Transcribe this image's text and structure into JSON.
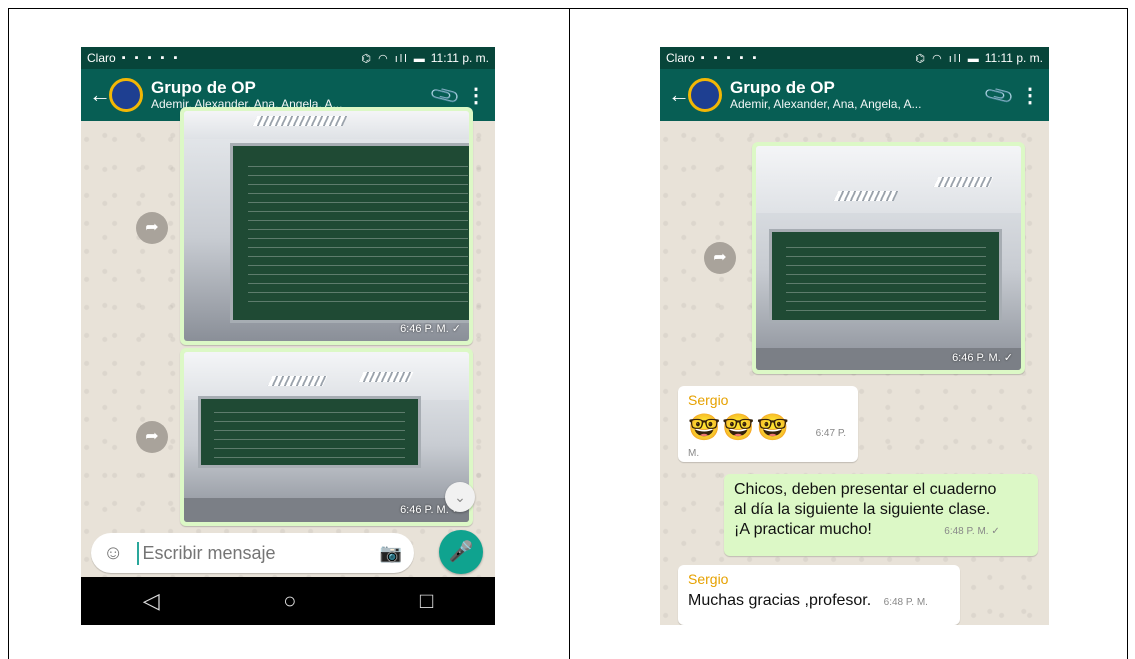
{
  "status": {
    "carrier": "Claro",
    "time": "11:11 p. m.",
    "left_icons": "▪ ▪ ▪ ▪ ▪",
    "right_icons": "⌬ ◠ ıll ▬"
  },
  "chat": {
    "group_title": "Grupo de OP",
    "subtitle": "Ademir, Alexander, Ana, Angela, A..."
  },
  "icons": {
    "back": "←",
    "attach": "📎",
    "more": "⋮",
    "forward": "➦",
    "emoji": "☺",
    "camera": "📷",
    "mic": "🎤",
    "nav_back": "◁",
    "nav_home": "○",
    "nav_recent": "□",
    "scroll_down": "⌄"
  },
  "left_screen": {
    "messages": [
      {
        "type": "image",
        "time": "6:46 P. M.",
        "check": "✓"
      },
      {
        "type": "image",
        "time": "6:46 P. M.",
        "check": "✓"
      }
    ],
    "input_placeholder": "Escribir mensaje"
  },
  "right_screen": {
    "messages": [
      {
        "type": "image",
        "time": "6:46 P. M.",
        "check": "✓"
      },
      {
        "type": "text",
        "direction": "in",
        "sender": "Sergio",
        "text": "🤓🤓🤓",
        "time": "6:47 P. M."
      },
      {
        "type": "text",
        "direction": "out",
        "line1": "Chicos, deben presentar el cuaderno",
        "line2": "al día la siguiente la siguiente clase.",
        "line3": "¡A practicar mucho!",
        "time": "6:48 P. M.",
        "check": "✓"
      },
      {
        "type": "text",
        "direction": "in",
        "sender": "Sergio",
        "text": "Muchas gracias ,profesor.",
        "time": "6:48 P. M."
      }
    ]
  },
  "colors": {
    "header": "#075e54",
    "statusbar": "#07453a",
    "outgoing": "#dcf8c6",
    "incoming": "#ffffff",
    "sender": "#e6a100",
    "mic": "#0fa38f"
  }
}
